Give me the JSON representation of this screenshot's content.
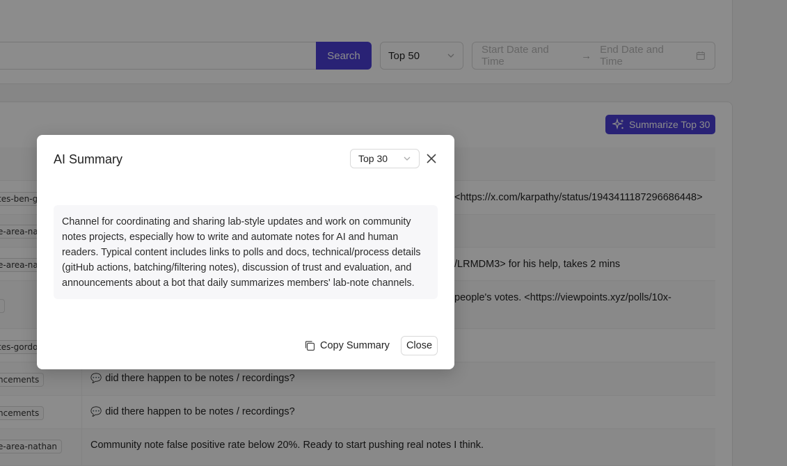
{
  "search": {
    "button_label": "Search",
    "input_value": ""
  },
  "filters": {
    "top_select": "Top 50",
    "start_placeholder": "Start Date and Time",
    "end_placeholder": "End Date and Time"
  },
  "summarize_button": "Summarize Top 30",
  "rows": [
    {
      "tag": "tes-ben-go",
      "message": "<https://x.com/karpathy/status/1943411187296686448>",
      "has_icon": false
    },
    {
      "tag": "e-area-nath",
      "message": "",
      "has_icon": false
    },
    {
      "tag": "e-area-nath",
      "message": "/LRMDM3> for his help, takes 2 mins",
      "has_icon": false
    },
    {
      "tag": "l",
      "message": "people's votes. <https://viewpoints.xyz/polls/10x-",
      "has_icon": false
    },
    {
      "tag": "tes-gordon",
      "message": "",
      "has_icon": false
    },
    {
      "tag": "ncements",
      "message": "did there happen to be notes / recordings?",
      "has_icon": true
    },
    {
      "tag": "ncements",
      "message": "did there happen to be notes / recordings?",
      "has_icon": true
    },
    {
      "tag": "e-area-nathan",
      "message": "Community note false positive rate below 20%. Ready to start pushing real notes I think.",
      "has_icon": false
    }
  ],
  "modal": {
    "title": "AI Summary",
    "select_value": "Top 30",
    "summary_text": "Channel for coordinating and sharing lab-style updates and work on community notes projects, especially how to write and automate notes for AI and human readers. Typical content includes links to polls and docs, technical/process details (gitHub actions, batching/filtering notes), discussion of trust and evaluation, and announcements about a bot that daily summarizes members' lab-note channels.",
    "copy_label": "Copy Summary",
    "close_label": "Close"
  },
  "colors": {
    "accent": "#4b3fd6"
  }
}
